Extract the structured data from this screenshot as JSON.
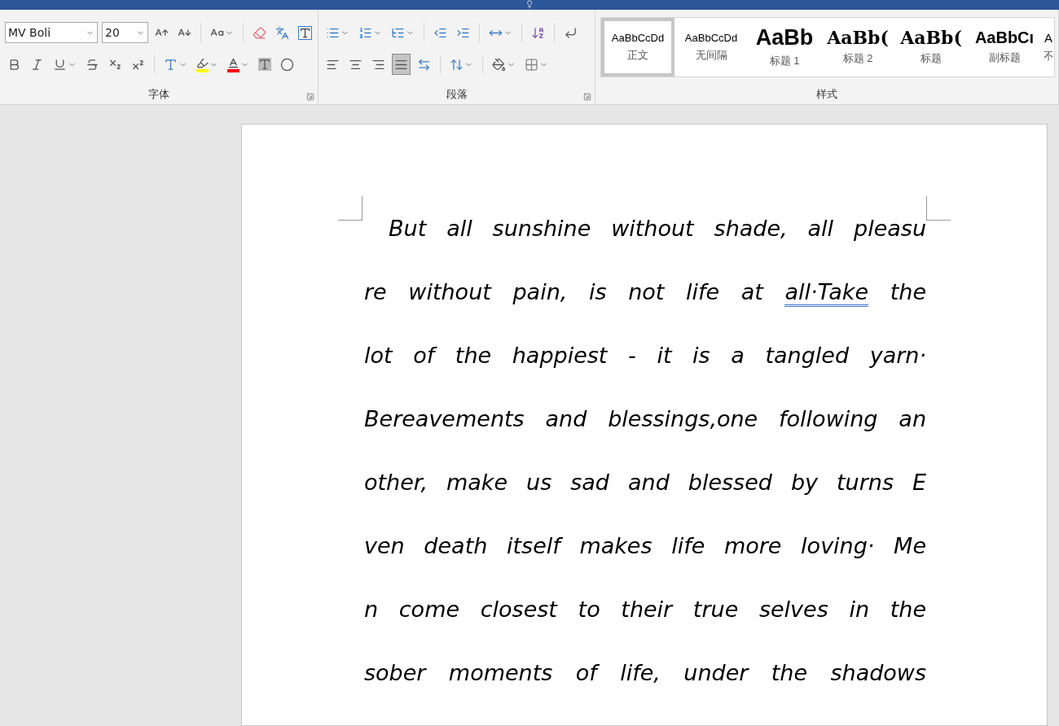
{
  "ribbon": {
    "font_group": {
      "font_name": "MV Boli",
      "font_size": "20",
      "label": "字体"
    },
    "paragraph_group": {
      "alignment": [
        {
          "selected": false
        },
        {
          "selected": false
        },
        {
          "selected": false
        },
        {
          "selected": true
        },
        {
          "selected": false
        }
      ],
      "label": "段落"
    },
    "styles_group": {
      "label": "样式",
      "styles": [
        {
          "kind": "normal",
          "preview": "AaBbCcDd",
          "name": "正文",
          "selected": true
        },
        {
          "kind": "normal",
          "preview": "AaBbCcDd",
          "name": "无间隔",
          "selected": false
        },
        {
          "kind": "heading1",
          "preview": "AaBb",
          "name": "标题 1",
          "selected": false
        },
        {
          "kind": "heading2",
          "preview": "AaBb(",
          "name": "标题 2",
          "selected": false
        },
        {
          "kind": "title",
          "preview": "AaBb(",
          "name": "标题",
          "selected": false
        },
        {
          "kind": "subtitle",
          "preview": "AaBbCı",
          "name": "副标题",
          "selected": false
        },
        {
          "kind": "partial",
          "preview": "A",
          "name": "不",
          "selected": false
        }
      ]
    }
  },
  "document": {
    "lines": [
      [
        {
          "text": "But all sunshine without shade, all pleasu",
          "flagged": false
        }
      ],
      [
        {
          "text": "re without pain, is not life at ",
          "flagged": false
        },
        {
          "text": "all·Take",
          "flagged": true
        },
        {
          "text": " the",
          "flagged": false
        }
      ],
      [
        {
          "text": "lot of the happiest - it is a tangled yarn·",
          "flagged": false
        }
      ],
      [
        {
          "text": "Bereavements and blessings,one following an",
          "flagged": false
        }
      ],
      [
        {
          "text": "other, make us sad and blessed by turns E",
          "flagged": false
        }
      ],
      [
        {
          "text": "ven death itself makes life more loving· Me",
          "flagged": false
        }
      ],
      [
        {
          "text": "n come closest to their true selves in the",
          "flagged": false
        }
      ],
      [
        {
          "text": "sober moments of life, under the shadows",
          "flagged": false
        }
      ]
    ]
  }
}
